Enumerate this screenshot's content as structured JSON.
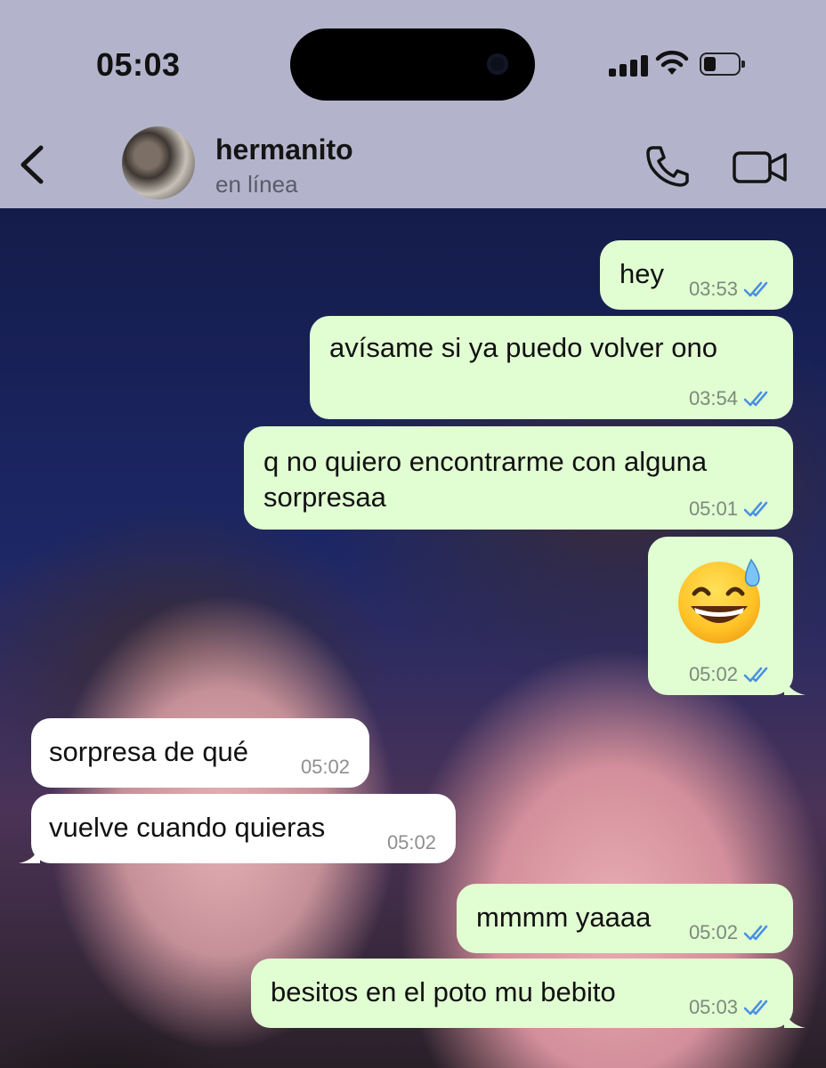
{
  "status_bar": {
    "time": "05:03",
    "battery_level": 0.35
  },
  "header": {
    "contact_name": "hermanito",
    "contact_status": "en línea"
  },
  "messages": [
    {
      "direction": "out",
      "text": "hey",
      "time": "03:53",
      "read": true
    },
    {
      "direction": "out",
      "text": "avísame si ya puedo volver ono",
      "time": "03:54",
      "read": true
    },
    {
      "direction": "out",
      "text": "q no quiero encontrarme con alguna sorpresaa",
      "time": "05:01",
      "read": true
    },
    {
      "direction": "out",
      "text": "",
      "emoji": "grinning-face-with-sweat-emoji",
      "time": "05:02",
      "read": true
    },
    {
      "direction": "in",
      "text": "sorpresa de qué",
      "time": "05:02"
    },
    {
      "direction": "in",
      "text": "vuelve cuando quieras",
      "time": "05:02"
    },
    {
      "direction": "out",
      "text": "mmmm yaaaa",
      "time": "05:02",
      "read": true
    },
    {
      "direction": "out",
      "text": "besitos en el poto mu bebito",
      "time": "05:03",
      "read": true
    }
  ],
  "colors": {
    "outgoing_bubble": "#e1fdd2",
    "incoming_bubble": "#ffffff",
    "read_ticks": "#4a90e2",
    "header_bg": "#b3b4cc"
  },
  "icons": [
    "back-chevron-icon",
    "phone-icon",
    "video-camera-icon",
    "signal-icon",
    "wifi-icon",
    "battery-icon",
    "double-check-icon"
  ]
}
